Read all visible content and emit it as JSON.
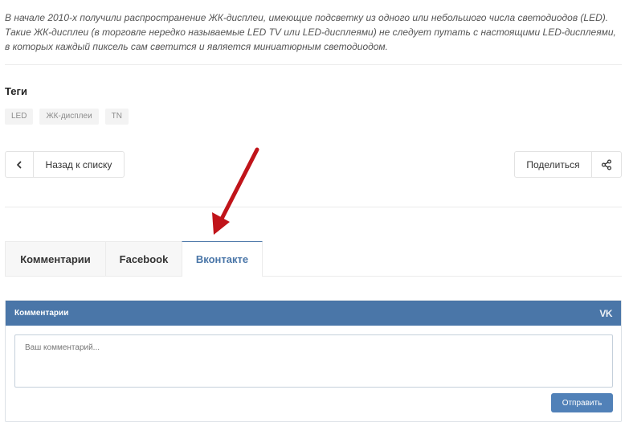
{
  "article": {
    "intro_text": "В начале 2010-х получили распространение ЖК-дисплеи, имеющие подсветку из одного или небольшого числа светодиодов (LED). Такие ЖК-дисплеи (в торговле нередко называемые LED TV или LED-дисплеями) не следует путать с настоящими LED-дисплеями, в которых каждый пиксель сам светится и является миниатюрным светодиодом."
  },
  "tags": {
    "title": "Теги",
    "items": [
      "LED",
      "ЖК-дисплеи",
      "TN"
    ]
  },
  "navigation": {
    "back_label": "Назад к списку",
    "share_label": "Поделиться"
  },
  "tabs": [
    {
      "label": "Комментарии",
      "active": false
    },
    {
      "label": "Facebook",
      "active": false
    },
    {
      "label": "Вконтакте",
      "active": true
    }
  ],
  "vk_widget": {
    "title": "Комментарии",
    "logo_text": "VK",
    "comment_placeholder": "Ваш комментарий...",
    "comment_value": "",
    "submit_label": "Отправить"
  },
  "colors": {
    "accent": "#4a76a8",
    "button": "#5181b8",
    "arrow": "#c0141a"
  }
}
